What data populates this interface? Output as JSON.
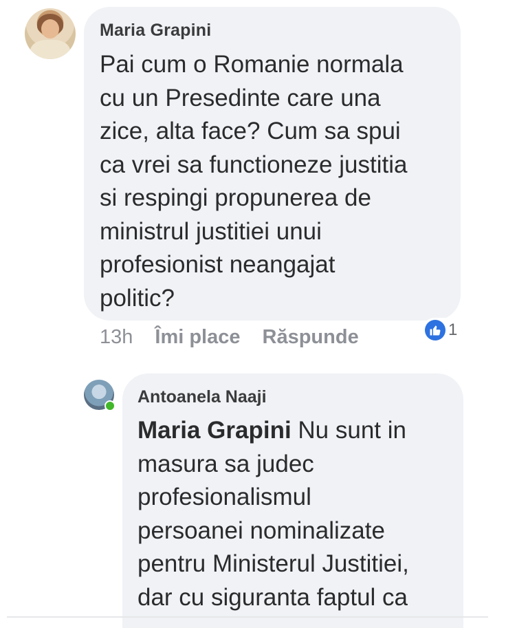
{
  "comment1": {
    "author": "Maria Grapini",
    "lines": [
      "Pai cum o Romanie normala",
      "cu un Presedinte care una",
      "zice, alta face? Cum sa spui",
      "ca vrei sa functioneze justitia",
      "si respingi propunerea de",
      "ministrul justitiei unui",
      "profesionist neangajat",
      "politic?"
    ],
    "time": "13h",
    "like_label": "Îmi place",
    "reply_label": "Răspunde",
    "reaction_icon": "thumbs-up-icon",
    "reaction_count": "1"
  },
  "comment2": {
    "author": "Antoanela Naaji",
    "mention": "Maria Grapini",
    "first_line_rest": " Nu sunt in",
    "lines": [
      "masura sa judec",
      "profesionalismul",
      "persoanei nominalizate",
      "pentru Ministerul Justitiei,",
      "dar cu siguranta faptul ca"
    ],
    "online_status": "online"
  },
  "colors": {
    "bubble": "#f0f2f5",
    "meta_text": "#8d9096",
    "like_blue": "#2d72e0",
    "online_green": "#42b72a"
  }
}
